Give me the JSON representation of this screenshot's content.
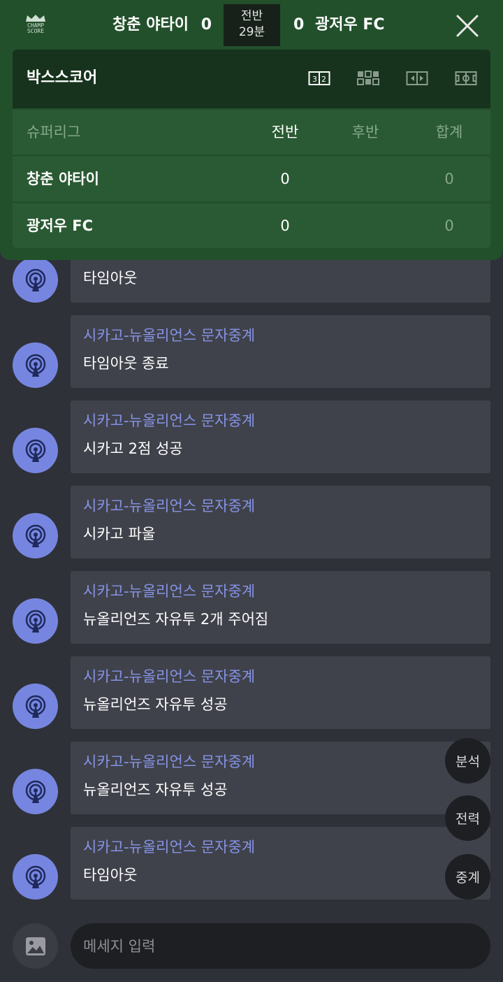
{
  "header": {
    "logo_text_top": "CHAMP",
    "logo_text_bottom": "SCORE",
    "home_team": "창춘 야타이",
    "home_score": "0",
    "away_score": "0",
    "away_team": "광저우 FC",
    "period": "전반",
    "minute": "29분"
  },
  "boxscore": {
    "title": "박스스코어",
    "league": "슈퍼리그",
    "columns": [
      "전반",
      "후반",
      "합계"
    ],
    "rows": [
      {
        "team": "창춘 야타이",
        "first": "0",
        "second": "",
        "total": "0"
      },
      {
        "team": "광저우 FC",
        "first": "0",
        "second": "",
        "total": "0"
      }
    ]
  },
  "feed": {
    "messages": [
      {
        "sender": "",
        "text": "타임아웃"
      },
      {
        "sender": "시카고-뉴올리언스 문자중계",
        "text": "타임아웃 종료"
      },
      {
        "sender": "시카고-뉴올리언스 문자중계",
        "text": "시카고 2점 성공"
      },
      {
        "sender": "시카고-뉴올리언스 문자중계",
        "text": "시카고 파울"
      },
      {
        "sender": "시카고-뉴올리언스 문자중계",
        "text": "뉴올리언즈 자유투 2개 주어짐"
      },
      {
        "sender": "시카고-뉴올리언스 문자중계",
        "text": "뉴올리언즈 자유투 성공"
      },
      {
        "sender": "시카고-뉴올리언스 문자중계",
        "text": "뉴올리언즈 자유투 성공"
      },
      {
        "sender": "시카고-뉴올리언스 문자중계",
        "text": "타임아웃"
      }
    ]
  },
  "fab": {
    "analysis": "분석",
    "record": "전력",
    "broadcast": "중계"
  },
  "composer": {
    "placeholder": "메세지 입력",
    "value": ""
  },
  "colors": {
    "panel": "#22502b",
    "panel_dark": "#17331d",
    "row": "#2a5a33",
    "background": "#2f3138",
    "bubble": "#40424b",
    "accent": "#8593e6",
    "avatar": "#7686e0"
  }
}
